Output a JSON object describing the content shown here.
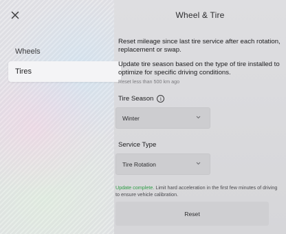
{
  "header": {
    "title": "Wheel & Tire",
    "close_icon": "close-icon"
  },
  "sidebar": {
    "items": [
      {
        "label": "Wheels",
        "selected": false
      },
      {
        "label": "Tires",
        "selected": true
      }
    ]
  },
  "main": {
    "reset_mileage_text": "Reset mileage since last tire service after each rotation, replacement or swap.",
    "tire_season_text": "Update tire season based on the type of tire installed to optimize for specific driving conditions.",
    "reset_note": "Reset less than 500 km ago",
    "tire_season": {
      "label": "Tire Season",
      "info_icon": "info-icon",
      "value": "Winter"
    },
    "service_type": {
      "label": "Service Type",
      "value": "Tire Rotation"
    },
    "status": {
      "highlight": "Update complete.",
      "message": " Limit hard acceleration in the first few minutes of driving to ensure vehicle calibration."
    },
    "reset_button_label": "Reset"
  },
  "colors": {
    "success": "#2e9d45",
    "selected_nav_bg": "#f4f4f6",
    "dropdown_bg": "#cdcdd0"
  }
}
